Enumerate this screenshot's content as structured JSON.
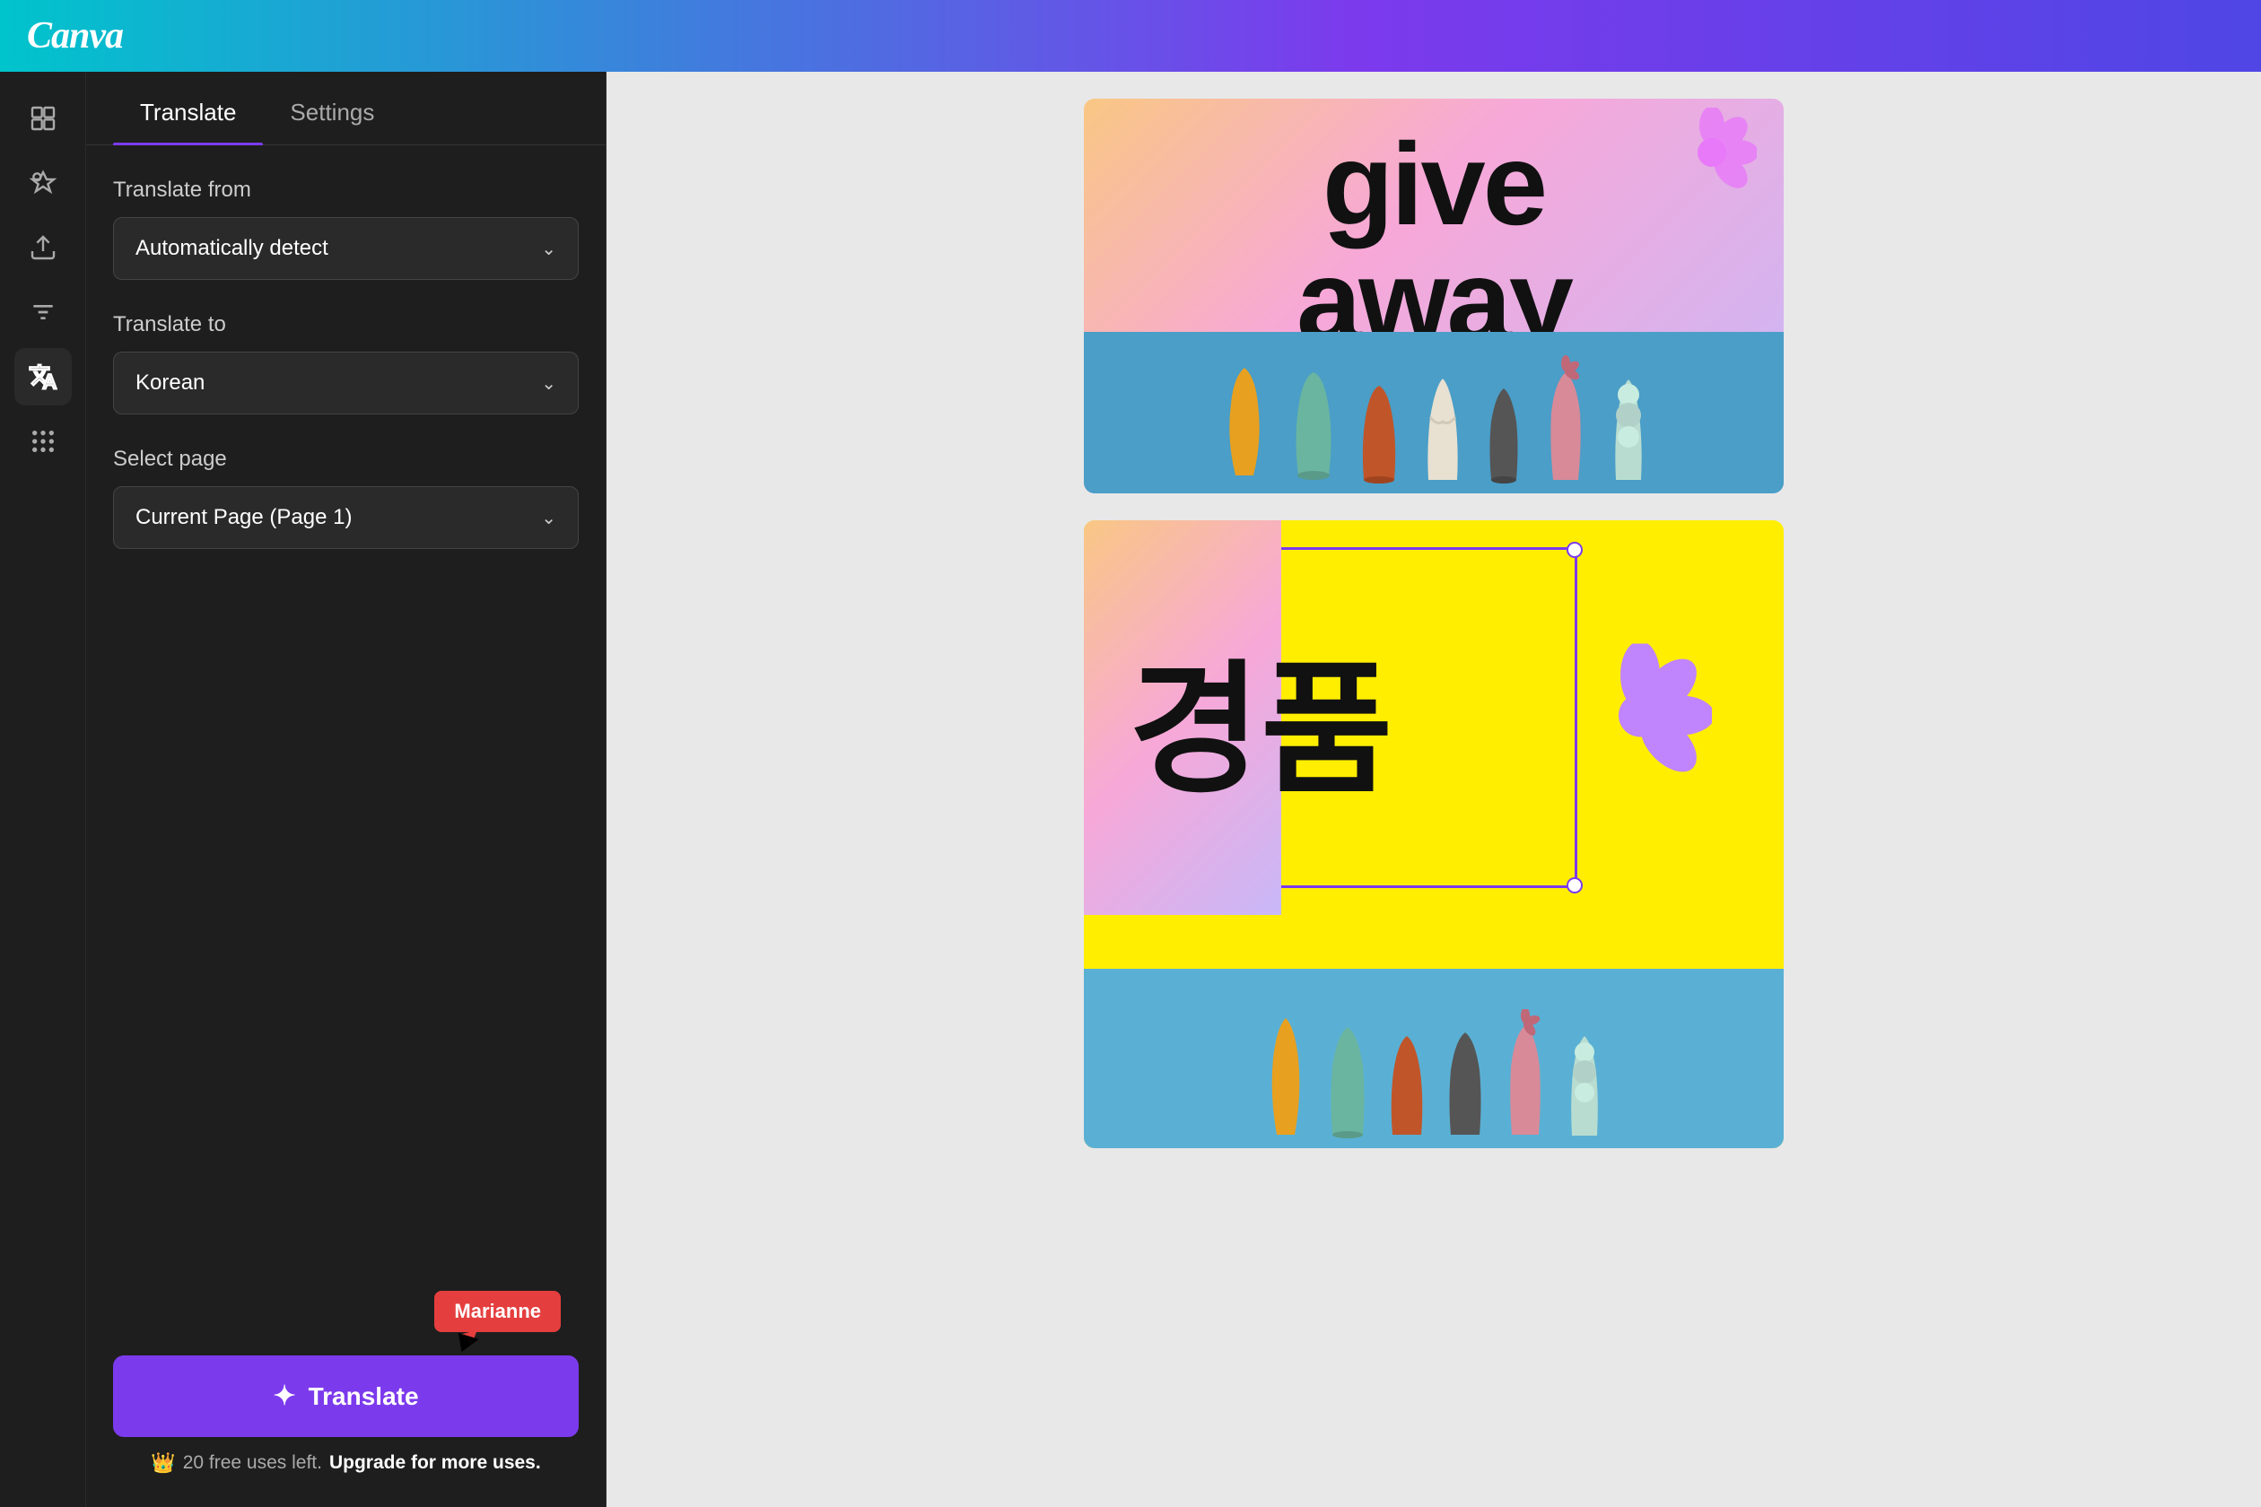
{
  "app": {
    "name": "Canva"
  },
  "topbar": {
    "logo": "Canva"
  },
  "sidebar": {
    "icons": [
      {
        "name": "layout-icon",
        "label": "Layout"
      },
      {
        "name": "elements-icon",
        "label": "Elements"
      },
      {
        "name": "upload-icon",
        "label": "Upload"
      },
      {
        "name": "text-icon",
        "label": "Text"
      },
      {
        "name": "translate-icon",
        "label": "Translate"
      },
      {
        "name": "apps-icon",
        "label": "Apps"
      }
    ]
  },
  "panel": {
    "tabs": [
      {
        "id": "translate",
        "label": "Translate",
        "active": true
      },
      {
        "id": "settings",
        "label": "Settings",
        "active": false
      }
    ],
    "translate_from_label": "Translate from",
    "translate_from_value": "Automatically detect",
    "translate_to_label": "Translate to",
    "translate_to_value": "Korean",
    "select_page_label": "Select page",
    "select_page_value": "Current Page (Page 1)"
  },
  "user": {
    "tooltip_name": "Marianne"
  },
  "translate_button": {
    "label": "Translate",
    "icon": "translate-star-icon"
  },
  "upgrade": {
    "text": "20 free uses left.",
    "cta": "Upgrade for more uses."
  },
  "canvas": {
    "card1": {
      "text_line1": "give",
      "text_line2": "away"
    },
    "card2": {
      "korean_text": "경품"
    }
  }
}
